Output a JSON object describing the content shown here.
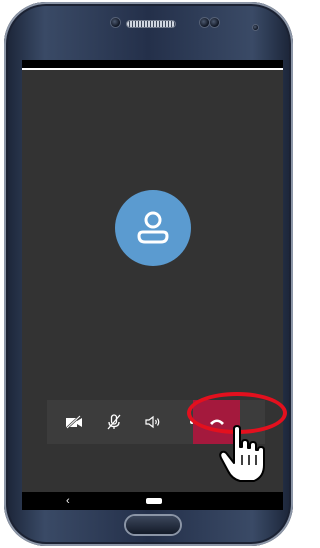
{
  "device": {
    "screen_bg": "#333333",
    "accent_avatar": "#5b9bd0",
    "accent_end_call": "#a4193d",
    "highlight_color": "#e3101e"
  },
  "call": {
    "avatar_icon": "person-icon"
  },
  "toolbar": {
    "buttons": [
      {
        "name": "video-off",
        "icon": "video-off-icon"
      },
      {
        "name": "mic-off",
        "icon": "mic-off-icon"
      },
      {
        "name": "speaker",
        "icon": "speaker-icon"
      },
      {
        "name": "more",
        "icon": "more-icon"
      }
    ],
    "end_call_icon": "end-call-icon"
  },
  "navbar": {
    "back_label": "‹"
  }
}
